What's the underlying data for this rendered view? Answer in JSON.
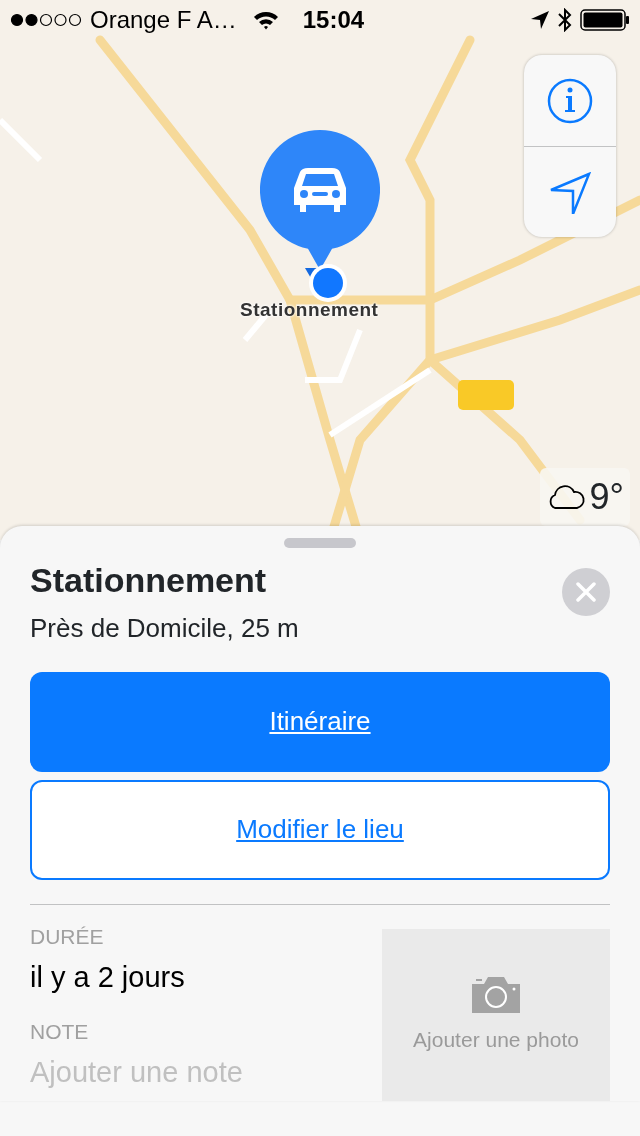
{
  "status_bar": {
    "carrier": "Orange F A…",
    "time": "15:04"
  },
  "map": {
    "kind": "picture",
    "pin_label": "Stationnement",
    "weather": "9°"
  },
  "sheet": {
    "title": "Stationnement",
    "subtitle": "Près de Domicile, 25 m",
    "buttons": [
      {
        "label": "Itinéraire",
        "kind": "primary"
      },
      {
        "label": "Modifier le lieu",
        "kind": "outline"
      }
    ],
    "fields": [
      {
        "label": "DURÉE",
        "value": "il y a 2 jours"
      },
      {
        "label": "NOTE",
        "placeholder": "Ajouter une note"
      }
    ],
    "photo": {
      "label": "Ajouter une photo"
    }
  }
}
